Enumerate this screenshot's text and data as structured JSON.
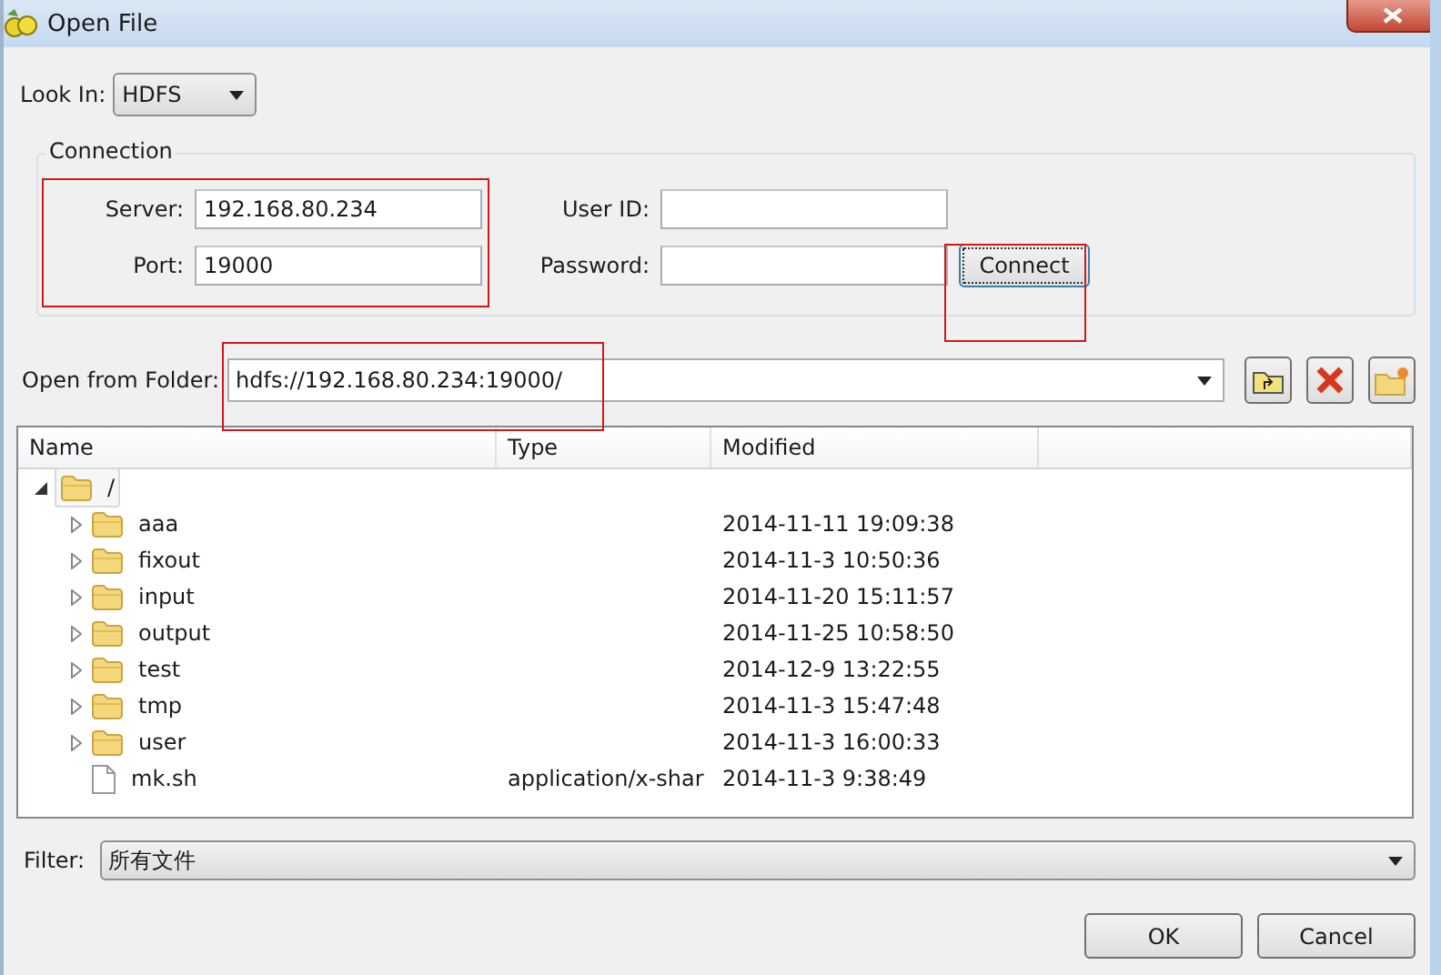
{
  "window": {
    "title": "Open File"
  },
  "look_in": {
    "label": "Look In:",
    "value": "HDFS"
  },
  "connection": {
    "title": "Connection",
    "server": {
      "label": "Server:",
      "value": "192.168.80.234"
    },
    "port": {
      "label": "Port:",
      "value": "19000"
    },
    "user_id": {
      "label": "User ID:"
    },
    "password": {
      "label": "Password:"
    },
    "connect_button": "Connect"
  },
  "folder": {
    "label": "Open from Folder:",
    "value": "hdfs://192.168.80.234:19000/"
  },
  "table": {
    "columns": [
      "Name",
      "Type",
      "Modified"
    ],
    "rows": [
      {
        "kind": "folder",
        "name": "/",
        "expanded": true,
        "selected": true,
        "children": [
          {
            "kind": "folder",
            "name": "aaa",
            "expanded": false,
            "selected": false,
            "modified": "2014-11-11 19:09:38"
          },
          {
            "kind": "folder",
            "name": "fixout",
            "expanded": false,
            "selected": false,
            "modified": "2014-11-3 10:50:36"
          },
          {
            "kind": "folder",
            "name": "input",
            "expanded": false,
            "selected": false,
            "modified": "2014-11-20 15:11:57"
          },
          {
            "kind": "folder",
            "name": "output",
            "expanded": false,
            "selected": false,
            "modified": "2014-11-25 10:58:50"
          },
          {
            "kind": "folder",
            "name": "test",
            "expanded": false,
            "selected": false,
            "modified": "2014-12-9 13:22:55"
          },
          {
            "kind": "folder",
            "name": "tmp",
            "expanded": false,
            "selected": false,
            "modified": "2014-11-3 15:47:48"
          },
          {
            "kind": "folder",
            "name": "user",
            "expanded": false,
            "selected": false,
            "modified": "2014-11-3 16:00:33"
          },
          {
            "kind": "file",
            "name": "mk.sh",
            "selected": false,
            "type": "application/x-shar",
            "modified": "2014-11-3 9:38:49"
          }
        ]
      }
    ]
  },
  "filter": {
    "label": "Filter:",
    "value": "所有文件"
  },
  "buttons": [
    "OK",
    "Cancel"
  ]
}
